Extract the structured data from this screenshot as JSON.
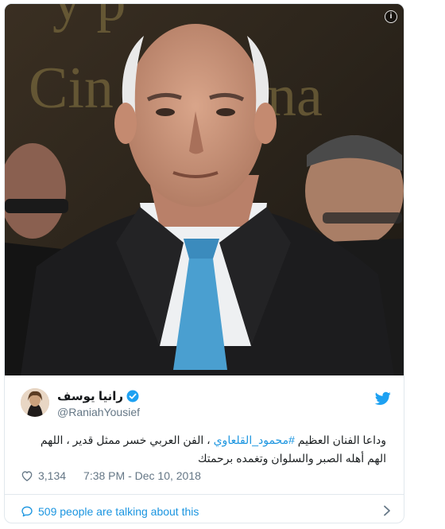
{
  "tweet": {
    "display_name": "رانيا يوسف",
    "handle": "@RaniahYousief",
    "text_before": "وداعا الفنان العظيم ",
    "hashtag": "#محمود_القلعاوي",
    "text_after": " ، الفن العربي خسر ممثل قدير ، اللهم الهم أهله الصبر والسلوان وتغمده برحمتك",
    "likes": "3,134",
    "timestamp": "7:38 PM - Dec 10, 2018",
    "conversation": "509 people are talking about this"
  },
  "colors": {
    "accent": "#1b95e0",
    "muted": "#657786",
    "border": "#e1e8ed",
    "verified": "#1da1f2"
  },
  "icons": {
    "info": "info-icon",
    "verified": "verified-badge-icon",
    "logo": "twitter-bird-icon",
    "like": "heart-icon",
    "reply": "speech-bubble-icon",
    "more": "chevron-right-icon"
  }
}
